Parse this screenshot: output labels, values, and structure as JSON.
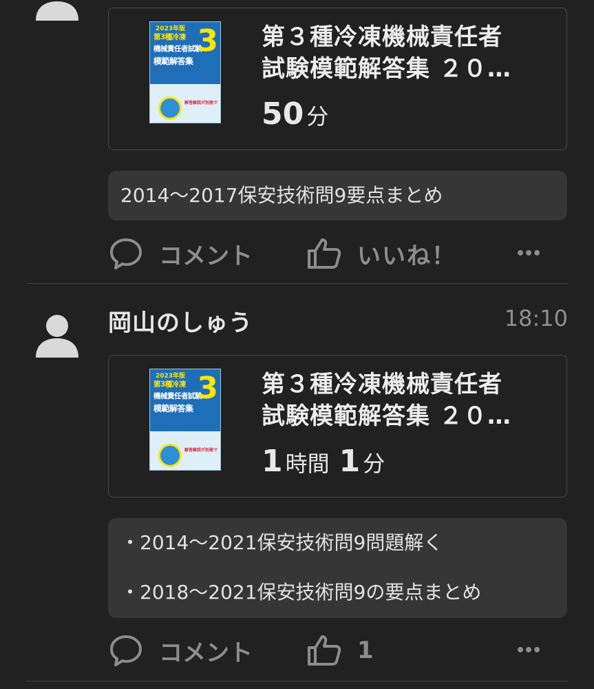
{
  "posts": [
    {
      "user": "",
      "time": "",
      "book": {
        "title_line1": "第３種冷凍機械責任者",
        "title_line2": "試験模範解答集 ２０…",
        "study_time": [
          {
            "value": "50",
            "unit": "分"
          }
        ]
      },
      "notes": [
        "2014〜2017保安技術問9要点まとめ"
      ],
      "actions": {
        "comment_label": "コメント",
        "like_label": "いいね！",
        "more": "•••"
      }
    },
    {
      "user": "岡山のしゅう",
      "time": "18:10",
      "book": {
        "title_line1": "第３種冷凍機械責任者",
        "title_line2": "試験模範解答集 ２０…",
        "study_time": [
          {
            "value": "1",
            "unit": "時間"
          },
          {
            "value": "1",
            "unit": "分"
          }
        ]
      },
      "notes": [
        "・2014〜2021保安技術問9問題解く",
        "・2018〜2021保安技術問9の要点まとめ"
      ],
      "actions": {
        "comment_label": "コメント",
        "like_label": "1",
        "more": "•••"
      }
    }
  ],
  "cover": {
    "year": "2023年版",
    "line1": "第3種冷凍",
    "line2": "機械責任者試験",
    "line3": "模範解答集",
    "number": "3",
    "badge": "解答解説が別冊で"
  },
  "colors": {
    "background": "#212121",
    "card_border": "#4a4a4a",
    "note_bg": "#363636",
    "muted": "#8d8d8d",
    "cover_blue": "#1f6fb8",
    "cover_yellow": "#ffe600"
  }
}
